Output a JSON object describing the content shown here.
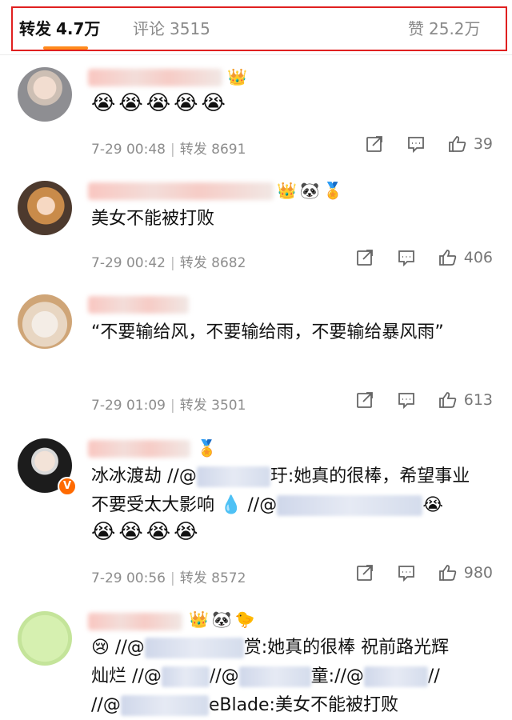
{
  "tabs": {
    "repost": {
      "label": "转发",
      "count": "4.7万"
    },
    "comment": {
      "label": "评论",
      "count": "3515"
    },
    "likes": {
      "label": "赞",
      "count": "25.2万"
    }
  },
  "comments": [
    {
      "text": "😭😭😭😭😭",
      "time": "7-29 00:48",
      "repost_label": "转发",
      "reposts": "8691",
      "likes": "39"
    },
    {
      "text": "美女不能被打败",
      "time": "7-29 00:42",
      "repost_label": "转发",
      "reposts": "8682",
      "likes": "406"
    },
    {
      "text": "“不要输给风，不要输给雨，不要输给暴风雨”",
      "time": "7-29 01:09",
      "repost_label": "转发",
      "reposts": "3501",
      "likes": "613"
    },
    {
      "text_a": "冰冰渡劫 //@",
      "text_b": "玗:她真的很棒，希望事业",
      "text_c": "不要受太大影响 💧 //@",
      "text_d": "😭",
      "emoji_line": "😭😭😭😭",
      "time": "7-29 00:56",
      "repost_label": "转发",
      "reposts": "8572",
      "likes": "980"
    },
    {
      "text_a": "😢 //@",
      "text_b": "赏:她真的很棒 祝前路光辉",
      "text_c": "灿烂 //@",
      "text_d": "//@",
      "text_e": "童://@",
      "text_f": "//",
      "text_g": "//@",
      "text_h": "eBlade:",
      "text_i": "美女不能被打败"
    }
  ],
  "icons": {
    "share": "share-icon",
    "comment": "comment-icon",
    "like": "thumb-up-icon"
  },
  "colors": {
    "accent": "#ff8a1c",
    "highlight_box": "#e02020",
    "mention": "#3a5a8c"
  }
}
